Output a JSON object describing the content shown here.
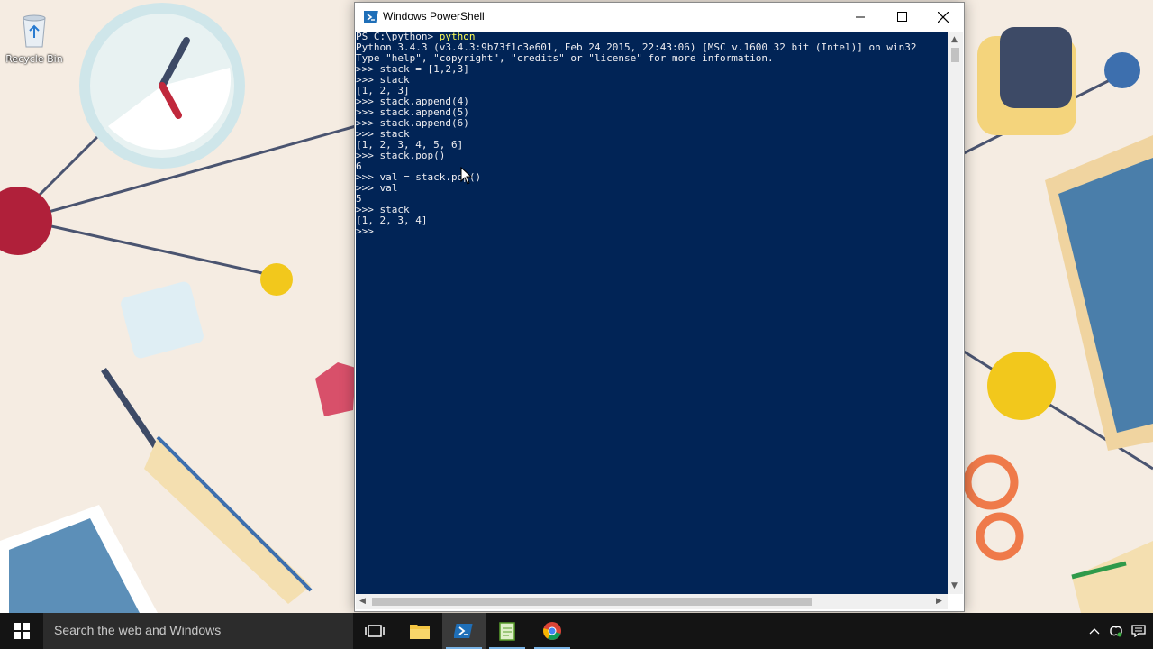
{
  "desktop": {
    "recycle_bin_label": "Recycle Bin"
  },
  "window": {
    "title": "Windows PowerShell",
    "icon": "powershell-icon"
  },
  "console": {
    "prompt": "PS C:\\python> ",
    "command": "python",
    "lines": [
      "Python 3.4.3 (v3.4.3:9b73f1c3e601, Feb 24 2015, 22:43:06) [MSC v.1600 32 bit (Intel)] on win32",
      "Type \"help\", \"copyright\", \"credits\" or \"license\" for more information.",
      ">>> stack = [1,2,3]",
      ">>> stack",
      "[1, 2, 3]",
      ">>> stack.append(4)",
      ">>> stack.append(5)",
      ">>> stack.append(6)",
      ">>> stack",
      "[1, 2, 3, 4, 5, 6]",
      ">>> stack.pop()",
      "6",
      ">>> val = stack.pop()",
      ">>> val",
      "5",
      ">>> stack",
      "[1, 2, 3, 4]",
      ">>> "
    ]
  },
  "taskbar": {
    "search_placeholder": "Search the web and Windows",
    "apps": [
      "task-view-icon",
      "file-explorer-icon",
      "powershell-icon",
      "notepad-icon",
      "chrome-icon"
    ],
    "active_app": "powershell-icon"
  },
  "colors": {
    "console_bg": "#012456",
    "console_fg": "#eeedf0",
    "command_highlight": "#fdfd55",
    "taskbar_bg": "#141414"
  }
}
